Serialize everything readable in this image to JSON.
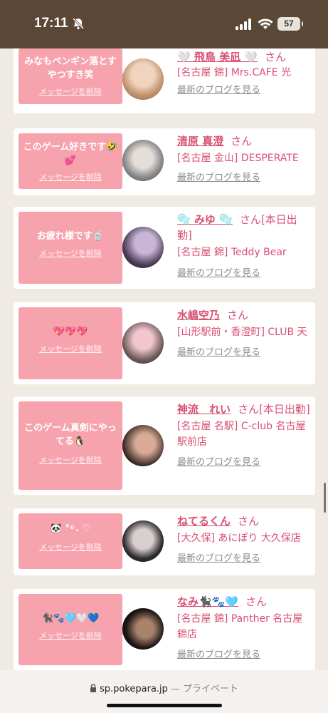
{
  "status": {
    "time": "17:11",
    "battery": "57"
  },
  "cards": [
    {
      "msg": "みなもペンギン落とすやつすき笑",
      "delete": "メッセージを削除",
      "name": "🤍 飛鳥 美凪 🤍",
      "san": "さん",
      "shop": "[名古屋 錦] Mrs.CAFE 光",
      "blog": "最新のブログを見る",
      "avatar": [
        "#c79a76",
        "#f0d4c0"
      ]
    },
    {
      "msg": "このゲーム好きです🤣💕",
      "delete": "メッセージを削除",
      "name": "清原 真澄",
      "san": "さん",
      "shop": "[名古屋 金山] DESPERATE",
      "blog": "最新のブログを見る",
      "avatar": [
        "#8a8a8a",
        "#e4ddd8"
      ]
    },
    {
      "msg": "お疲れ様です🍵",
      "delete": "メッセージを削除",
      "name": "🫧 みゆ 🫧",
      "san": "さん[本日出勤]",
      "shop": "[名古屋 錦] Teddy Bear",
      "blog": "最新のブログを見る",
      "avatar": [
        "#4a3a55",
        "#c9b6d6"
      ]
    },
    {
      "msg": "💖💖💖",
      "delete": "メッセージを削除",
      "name": "水嶋空乃",
      "san": "さん",
      "shop": "[山形駅前・香澄町] CLUB 天",
      "blog": "最新のブログを見る",
      "avatar": [
        "#6b5a58",
        "#f2c6cf"
      ]
    },
    {
      "msg": "このゲーム真剣にやってる🐧",
      "delete": "メッセージを削除",
      "name": "神流　れい",
      "san": "さん[本日出勤]",
      "shop": "[名古屋 名駅] C-club 名古屋駅前店",
      "blog": "最新のブログを見る",
      "avatar": [
        "#3a2a26",
        "#d7ab95"
      ]
    },
    {
      "msg": "🐼 ° ͦ . ♡",
      "delete": "メッセージを削除",
      "name": "ねてるくん",
      "san": "さん",
      "shop": "[大久保] あにぽり 大久保店",
      "blog": "最新のブログを見る",
      "avatar": [
        "#2f2b2e",
        "#d9cfcf"
      ]
    },
    {
      "msg": "🐈‍⬛🐾🩵🤍💙",
      "delete": "メッセージを削除",
      "name": "なみ🐈‍⬛🐾🩵",
      "san": "さん",
      "shop": "[名古屋 錦] Panther 名古屋錦店",
      "blog": "最新のブログを見る",
      "avatar": [
        "#1c1614",
        "#a9826c"
      ]
    }
  ],
  "bottom": {
    "domain": "sp.pokepara.jp",
    "separator": "— プライベート"
  }
}
